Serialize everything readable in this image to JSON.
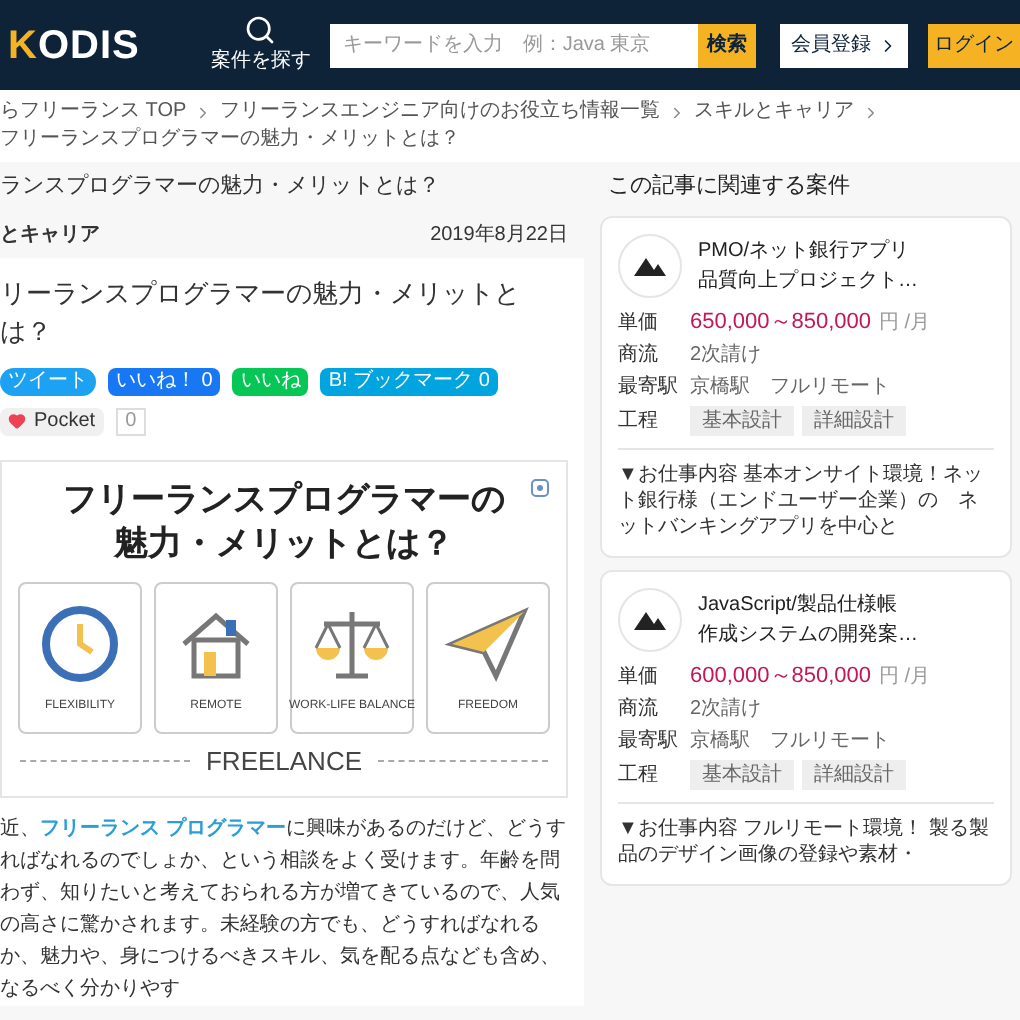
{
  "header": {
    "logo": "KODIS",
    "search_link": "案件を探す",
    "search": {
      "placeholder": "キーワードを入力　例：Java 東京",
      "button": "検索"
    },
    "register": "会員登録",
    "login": "ログイン"
  },
  "breadcrumb": [
    "らフリーランス TOP",
    "フリーランスエンジニア向けのお役立ち情報一覧",
    "スキルとキャリア",
    "フリーランスプログラマーの魅力・メリットとは？"
  ],
  "page_title": "ランスプログラマーの魅力・メリットとは？",
  "article": {
    "category": "とキャリア",
    "date": "2019年8月22日",
    "title": "リーランスプログラマーの魅力・メリットとは？",
    "share": [
      {
        "kind": "twitter",
        "label": "ツイート"
      },
      {
        "kind": "facebook",
        "label": "いいね！ 0"
      },
      {
        "kind": "line",
        "label": "いいね"
      },
      {
        "kind": "hatena",
        "label": "B! ブックマーク 0"
      },
      {
        "kind": "pocket",
        "label": "Pocket",
        "count": "0"
      }
    ],
    "figure": {
      "title_lines": [
        "フリーランスプログラマーの",
        "魅力・メリットとは？"
      ],
      "panels": [
        {
          "kind": "clock",
          "label": "FLEXIBILITY"
        },
        {
          "kind": "house",
          "label": "REMOTE"
        },
        {
          "kind": "scale",
          "label": "WORK-LIFE BALANCE"
        },
        {
          "kind": "plane",
          "label": "FREEDOM"
        }
      ],
      "caption": "FREELANCE"
    },
    "body": {
      "lead": "近、",
      "link": "フリーランス プログラマー",
      "rest": "に興味があるのだけど、どうすればなれるのでしょか、という相談をよく受けます。年齢を問わず、知りたいと考えておられる方が増てきているので、人気の高さに驚かされます。未経験の方でも、どうすればなれるか、魅力や、身につけるべきスキル、気を配る点なども含め、なるべく分かりやす"
    }
  },
  "sidebar": {
    "heading": "この記事に関連する案件",
    "jobs": [
      {
        "title_lines": [
          "PMO/ネット銀行アプリ",
          "品質向上プロジェクト…"
        ],
        "price": "650,000～850,000",
        "unit": "円 /月",
        "rows": [
          {
            "label": "単価"
          },
          {
            "label": "商流",
            "value": "2次請け"
          },
          {
            "label": "最寄駅",
            "value": "京橋駅　フルリモート"
          },
          {
            "label": "工程",
            "tags": [
              "基本設計",
              "詳細設計"
            ]
          }
        ],
        "description": [
          "▼お仕事内容 基本オンサイト環境！",
          "ネット銀行様（エンドユーザー企業）",
          "の　ネットバンキングアプリを中心と"
        ]
      },
      {
        "title_lines": [
          "JavaScript/製品仕様帳",
          "作成システムの開発案…"
        ],
        "price": "600,000～850,000",
        "unit": "円 /月",
        "rows": [
          {
            "label": "単価"
          },
          {
            "label": "商流",
            "value": "2次請け"
          },
          {
            "label": "最寄駅",
            "value": "京橋駅　フルリモート"
          },
          {
            "label": "工程",
            "tags": [
              "基本設計",
              "詳細設計"
            ]
          }
        ],
        "description": [
          "▼お仕事内容 フルリモート環境！ 製",
          "る製品のデザイン画像の登録や素材・"
        ]
      }
    ]
  }
}
